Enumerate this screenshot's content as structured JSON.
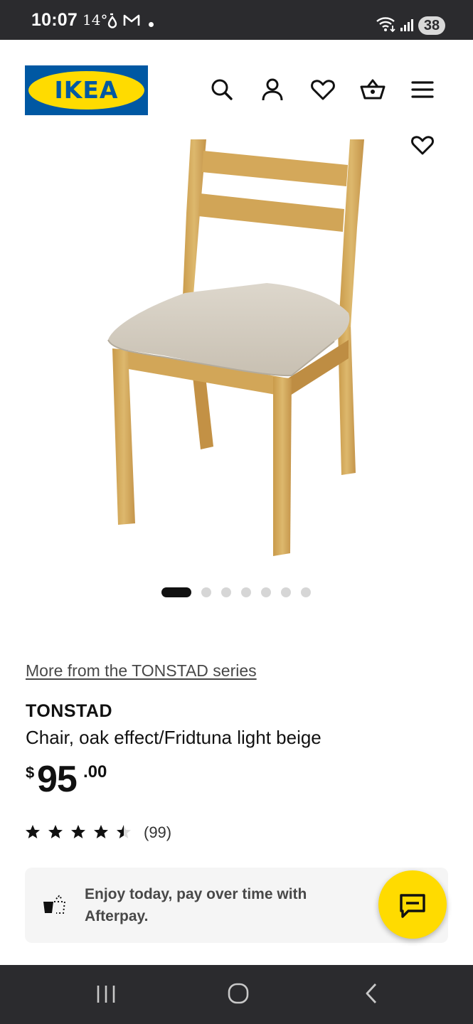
{
  "status_bar": {
    "time": "10:07",
    "temperature": "14°",
    "battery": "38",
    "icons": [
      "drop-icon",
      "mail-icon",
      "wifi-icon",
      "signal-icon"
    ]
  },
  "header": {
    "logo_text": "IKEA",
    "icons": [
      "search-icon",
      "account-icon",
      "favorites-icon",
      "cart-icon",
      "menu-icon"
    ]
  },
  "carousel": {
    "total": 7,
    "active": 1
  },
  "product": {
    "series_link": "More from the TONSTAD series",
    "name": "TONSTAD",
    "description": "Chair, oak effect/Fridtuna light beige",
    "price_currency": "$",
    "price_integer": "95",
    "price_decimal": ".00",
    "rating": 4.5,
    "rating_max": 5,
    "review_count": "(99)"
  },
  "afterpay": {
    "text": "Enjoy today, pay over time with Afterpay."
  },
  "colors": {
    "ikea_blue": "#0058a3",
    "ikea_yellow": "#ffdb00",
    "system_bar": "#2b2b2e"
  }
}
